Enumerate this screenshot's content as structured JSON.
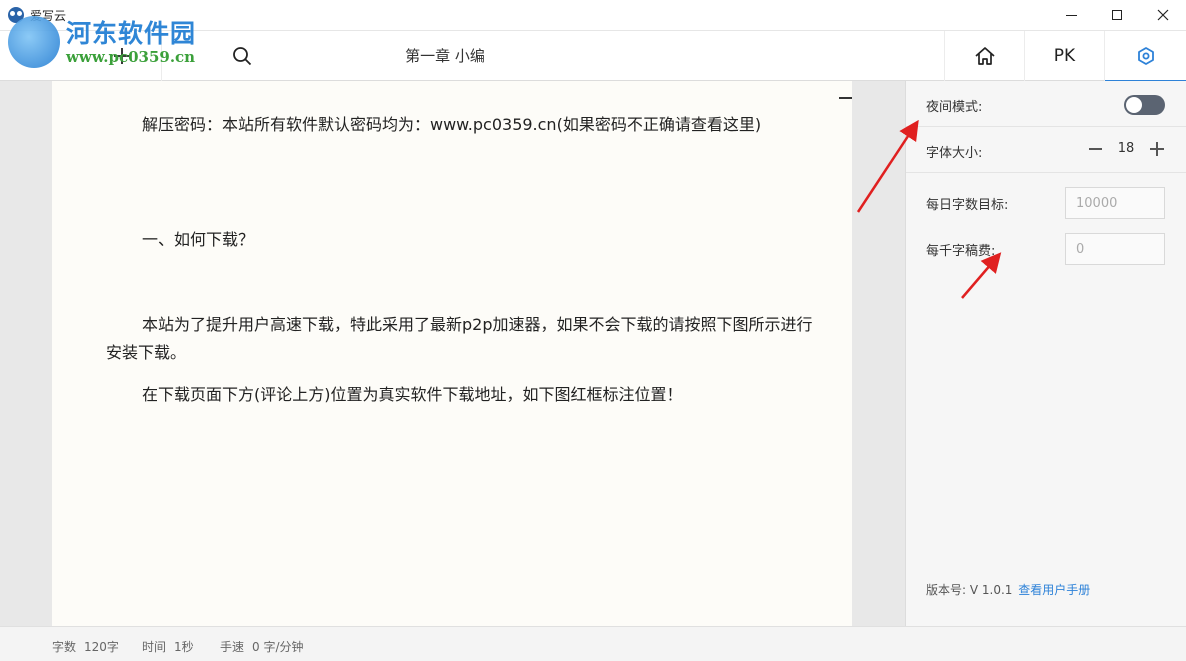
{
  "window": {
    "title": "爱写云"
  },
  "watermark": {
    "title": "河东软件园",
    "url": "www.pc0359.cn"
  },
  "toolbar": {
    "chapter_title": "第一章 小编",
    "pk_label": "PK"
  },
  "editor": {
    "paragraphs": [
      "解压密码：本站所有软件默认密码均为：www.pc0359.cn(如果密码不正确请查看这里)",
      "一、如何下载？",
      "本站为了提升用户高速下载，特此采用了最新p2p加速器，如果不会下载的请按照下图所示进行安装下载。",
      "在下载页面下方(评论上方)位置为真实软件下载地址，如下图红框标注位置！"
    ]
  },
  "settings": {
    "night_mode_label": "夜间模式:",
    "night_mode_on": false,
    "font_size_label": "字体大小:",
    "font_size_value": "18",
    "daily_goal_label": "每日字数目标:",
    "daily_goal_placeholder": "10000",
    "fee_label": "每千字稿费:",
    "fee_placeholder": "0",
    "version_label": "版本号: V 1.0.1",
    "manual_link": "查看用户手册"
  },
  "status": {
    "word_count_label": "字数",
    "word_count_value": "120字",
    "time_label": "时间",
    "time_value": "1秒",
    "speed_label": "手速",
    "speed_value": "0 字/分钟"
  },
  "colors": {
    "accent": "#2e82d8",
    "annotation": "#e02020",
    "toggle_off": "#5b6472"
  },
  "icons": [
    "plus-icon",
    "search-icon",
    "home-icon",
    "settings-hexagon-icon",
    "owl-logo-icon",
    "annotation-arrow"
  ]
}
